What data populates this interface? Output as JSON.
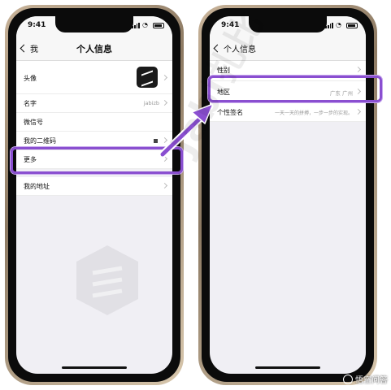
{
  "status": {
    "time": "9:41"
  },
  "left_screen": {
    "back_label": "我",
    "title": "个人信息",
    "rows": [
      {
        "label": "头像",
        "value": ""
      },
      {
        "label": "名字",
        "value": "jabizb"
      },
      {
        "label": "微信号",
        "value": ""
      },
      {
        "label": "我的二维码",
        "value": ""
      },
      {
        "label": "更多",
        "value": ""
      },
      {
        "label": "我的地址",
        "value": ""
      }
    ]
  },
  "right_screen": {
    "back_label": "个人信息",
    "rows": [
      {
        "label": "性别",
        "value": ""
      },
      {
        "label": "地区",
        "value": "广东 广州"
      },
      {
        "label": "个性签名",
        "value": "一天一天的拼搏，一步一步的实现。"
      }
    ]
  },
  "watermark": "Jabi扎比",
  "credit": "悟空问答",
  "colors": {
    "highlight": "#8a4fd0",
    "arrow": "#8a4fd0",
    "screen_bg": "#f0eff4"
  },
  "icons": [
    "avatar-icon",
    "qr-code-icon",
    "chevron-right-icon",
    "chevron-left-icon",
    "signal-icon",
    "wifi-icon",
    "battery-icon",
    "arrow-icon"
  ]
}
